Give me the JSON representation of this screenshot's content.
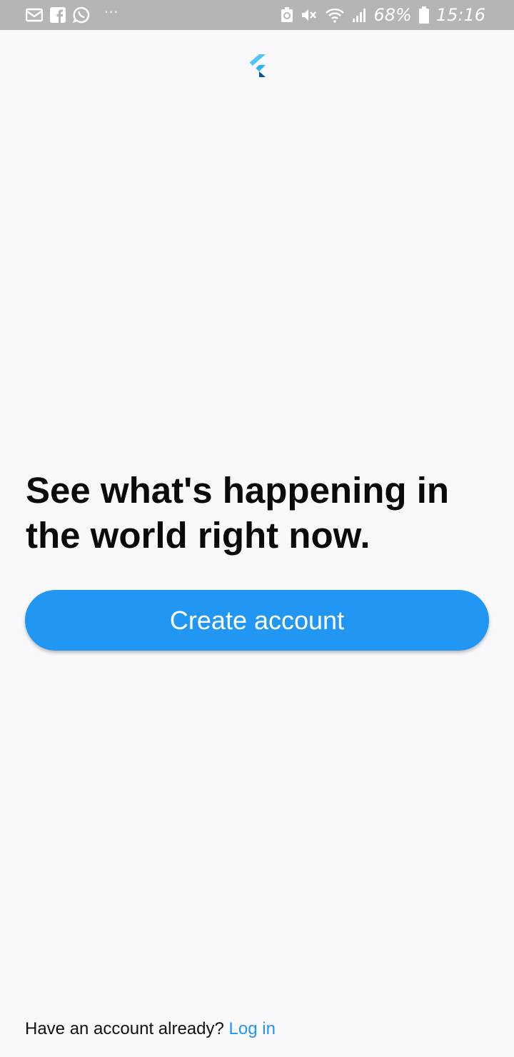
{
  "status_bar": {
    "left_icons": [
      "mail-icon",
      "facebook-icon",
      "whatsapp-icon"
    ],
    "overflow": "···",
    "right_icons": [
      "battery-saver-icon",
      "mute-icon",
      "wifi-icon",
      "signal-icon"
    ],
    "battery_percent": "68%",
    "time": "15:16"
  },
  "logo": {
    "icon": "flutter-logo-icon",
    "colors": [
      "#54c5f8",
      "#29b6f6",
      "#01579b"
    ]
  },
  "main": {
    "headline": "See what's happening in the world right now.",
    "create_account_label": "Create account"
  },
  "footer": {
    "prompt": "Have an account already?",
    "login_label": "Log in"
  },
  "colors": {
    "accent": "#2196f3",
    "background": "#f9f9fb",
    "status_bar": "#b5b5b5"
  }
}
